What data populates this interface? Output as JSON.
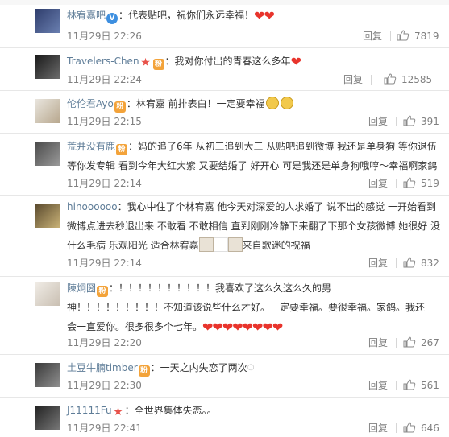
{
  "actions": {
    "reply_label": "回复"
  },
  "comments": [
    {
      "username": "林宥嘉吧",
      "content": "：代表贴吧，祝你们永远幸福！",
      "time": "11月29日 22:26",
      "likes": "7819",
      "avatar_colors": [
        "#2f3e6d",
        "#6a7fb0"
      ]
    },
    {
      "username": "Travelers-Chen",
      "content": "：我对你付出的青春这么多年",
      "time": "11月29日 22:24",
      "likes": "12585",
      "avatar_colors": [
        "#1a1a1a",
        "#6b6b6b"
      ]
    },
    {
      "username": "伦伦君Ayo",
      "content": "：林宥嘉 前排表白！一定要幸福",
      "time": "11月29日 22:15",
      "likes": "391",
      "avatar_colors": [
        "#e9e5de",
        "#b8a88e"
      ]
    },
    {
      "username": "荒井没有鹿",
      "content": "：妈的追了6年 从初三追到大三 从贴吧追到微博 我还是单身狗 等你退伍等你发专辑 看到今年大红大紫 又要结婚了 好开心 可是我还是单身狗哦哼～幸福啊家鸽",
      "time": "11月29日 22:14",
      "likes": "519",
      "avatar_colors": [
        "#4a4a4a",
        "#9a9a9a"
      ]
    },
    {
      "username": "hinoooooo",
      "content": "：我心中住了个林宥嘉 他今天对深爱的人求婚了 说不出的感觉 一开始看到微博点进去秒退出来 不敢看 不敢相信 直到刚刚冷静下来翻了下那个女孩微博 她很好 没什么毛病 乐观阳光 适合林宥嘉",
      "content_tail": "来自歌迷的祝福",
      "time": "11月29日 22:14",
      "likes": "832",
      "avatar_colors": [
        "#5a4a2e",
        "#c9b277"
      ]
    },
    {
      "username": "陳炯圀",
      "content_line1": "：！！！！！！！！！！我喜欢了这么久这么久的男",
      "content_line2": "神！！！！！！！！！不知道该说些什么才好。一定要幸福。要很幸福。家鸽。我还",
      "content_line3": "会一直爱你。很多很多个七年。",
      "time": "11月29日 22:20",
      "likes": "267",
      "avatar_colors": [
        "#f0ece6",
        "#c9bfb2"
      ]
    },
    {
      "username": "土豆牛腩timber",
      "content": "：一天之内失恋了两次",
      "time": "11月29日 22:30",
      "likes": "561",
      "avatar_colors": [
        "#3a3a3a",
        "#8f8f8f"
      ]
    },
    {
      "username": "J11111Fu",
      "content": "：全世界集体失恋。。",
      "time": "11月29日 22:41",
      "likes": "646",
      "avatar_colors": [
        "#222222",
        "#777777"
      ]
    }
  ]
}
